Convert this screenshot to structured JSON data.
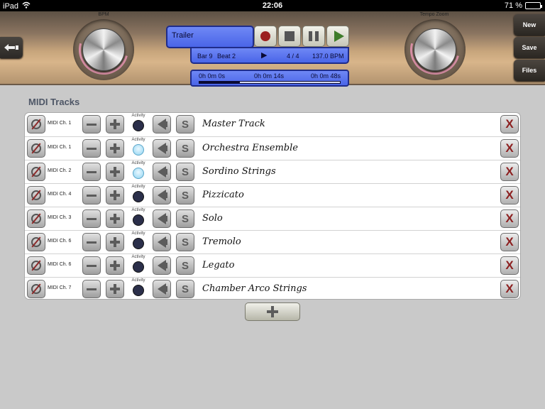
{
  "status_bar": {
    "device": "iPad",
    "time": "22:06",
    "battery": "71 %",
    "battery_level": 0.71
  },
  "toolbar": {
    "bpm_label": "BPM",
    "tempo_zoom_label": "Tempo Zoom",
    "song_name": "Trailer",
    "bar": "Bar 9",
    "beat": "Beat 2",
    "play_indicator": "▶",
    "time_signature": "4 / 4",
    "tempo": "137.0 BPM",
    "time_start": "0h 0m 0s",
    "time_current": "0h 0m 14s",
    "time_end": "0h 0m 48s",
    "progress": 0.29,
    "new_label": "New",
    "save_label": "Save",
    "files_label": "Files",
    "back_icon": "back-arrow-icon",
    "record_icon": "record-icon",
    "stop_icon": "stop-icon",
    "pause_icon": "pause-icon",
    "play_icon": "play-icon",
    "colors": {
      "display_blue": "#4a65e8",
      "record_red": "#9b2020",
      "play_green": "#3e7c2a",
      "delete_red": "#8c1f1f"
    }
  },
  "main": {
    "section_title": "MIDI Tracks",
    "activity_label": "Activity",
    "solo_label": "S",
    "delete_label": "X",
    "tracks": [
      {
        "channel": "MIDI Ch. 1",
        "name": "Master Track",
        "active": false
      },
      {
        "channel": "MIDI Ch. 1",
        "name": "Orchestra Ensemble",
        "active": true
      },
      {
        "channel": "MIDI Ch. 2",
        "name": "Sordino Strings",
        "active": true
      },
      {
        "channel": "MIDI Ch. 4",
        "name": "Pizzicato",
        "active": false
      },
      {
        "channel": "MIDI Ch. 3",
        "name": "Solo",
        "active": false
      },
      {
        "channel": "MIDI Ch. 6",
        "name": "Tremolo",
        "active": false
      },
      {
        "channel": "MIDI Ch. 6",
        "name": "Legato",
        "active": false
      },
      {
        "channel": "MIDI Ch. 7",
        "name": "Chamber Arco Strings",
        "active": false
      }
    ]
  }
}
